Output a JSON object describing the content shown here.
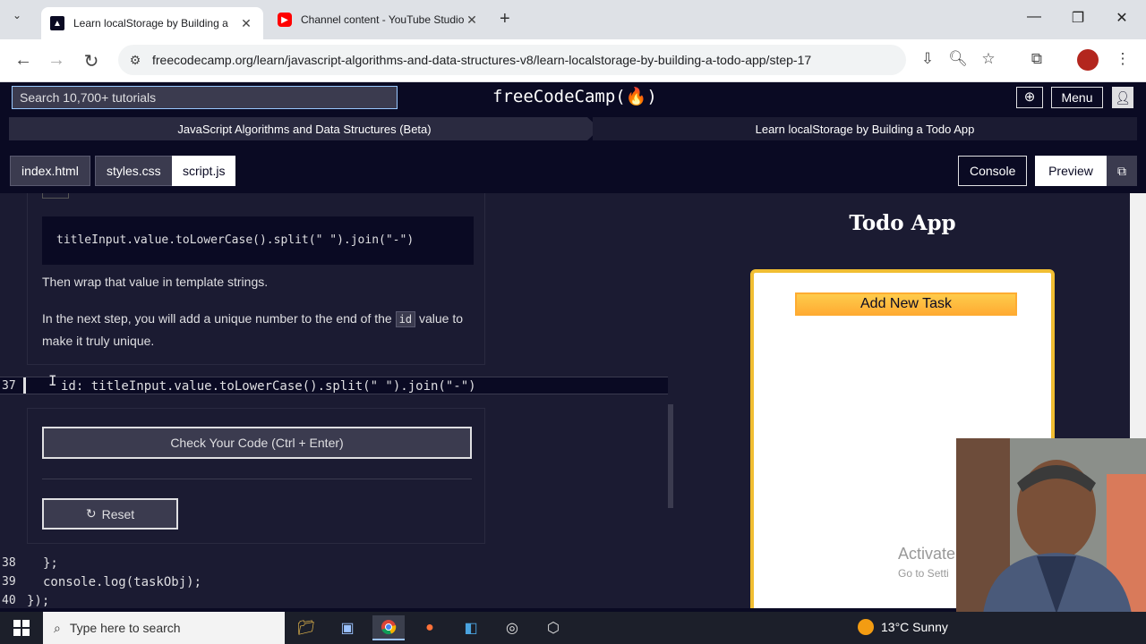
{
  "browser": {
    "tabs": [
      {
        "title": "Learn localStorage by Building a",
        "favicon": "fcc-icon"
      },
      {
        "title": "Channel content - YouTube Studio",
        "favicon": "youtube-icon"
      }
    ],
    "url": "freecodecamp.org/learn/javascript-algorithms-and-data-structures-v8/learn-localstorage-by-building-a-todo-app/step-17"
  },
  "fcc": {
    "search_placeholder": "Search 10,700+ tutorials",
    "logo": "freeCodeCamp(🔥)",
    "menu_label": "Menu",
    "breadcrumb": [
      "JavaScript Algorithms and Data Structures (Beta)",
      "Learn localStorage by Building a Todo App"
    ]
  },
  "editor": {
    "file_tabs": [
      "index.html",
      "styles.css",
      "script.js"
    ],
    "console_label": "Console",
    "preview_label": "Preview",
    "code_example": "titleInput.value.toLowerCase().split(\" \").join(\"-\")",
    "instruction_1": "Then wrap that value in template strings.",
    "instruction_2_a": "In the next step, you will add a unique number to the end of the",
    "instruction_2_code": "id",
    "instruction_2_b": "value",
    "instruction_2_c": "to make it truly unique.",
    "current_line_number": "37",
    "current_line": "id: titleInput.value.toLowerCase().split(\" \").join(\"-\")",
    "check_button": "Check Your Code (Ctrl + Enter)",
    "reset_button": "Reset",
    "lines": [
      {
        "num": "38",
        "text": "};"
      },
      {
        "num": "39",
        "text": "console.log(taskObj);"
      },
      {
        "num": "40",
        "text": "});"
      }
    ]
  },
  "preview": {
    "title": "Todo App",
    "add_task_button": "Add New Task",
    "watermark_1": "Activate",
    "watermark_2": "Go to Setti"
  },
  "taskbar": {
    "search_placeholder": "Type here to search",
    "weather": "13°C  Sunny"
  }
}
